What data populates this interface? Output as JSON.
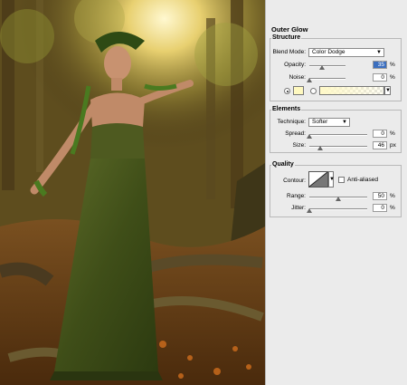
{
  "panel": {
    "title": "Outer Glow",
    "structure": {
      "label": "Structure",
      "blend_mode_label": "Blend Mode:",
      "blend_mode_value": "Color Dodge",
      "opacity_label": "Opacity:",
      "opacity_value": "35",
      "opacity_unit": "%",
      "opacity_level": 0.35,
      "noise_label": "Noise:",
      "noise_value": "0",
      "noise_unit": "%",
      "noise_level": 0,
      "glow_color": "#fff9c0"
    },
    "elements": {
      "label": "Elements",
      "technique_label": "Technique:",
      "technique_value": "Softer",
      "spread_label": "Spread:",
      "spread_value": "0",
      "spread_unit": "%",
      "spread_level": 0,
      "size_label": "Size:",
      "size_value": "46",
      "size_unit": "px",
      "size_level": 0.18
    },
    "quality": {
      "label": "Quality",
      "contour_label": "Contour:",
      "anti_aliased_label": "Anti-aliased",
      "range_label": "Range:",
      "range_value": "50",
      "range_unit": "%",
      "range_level": 0.5,
      "jitter_label": "Jitter:",
      "jitter_value": "0",
      "jitter_unit": "%",
      "jitter_level": 0
    }
  }
}
